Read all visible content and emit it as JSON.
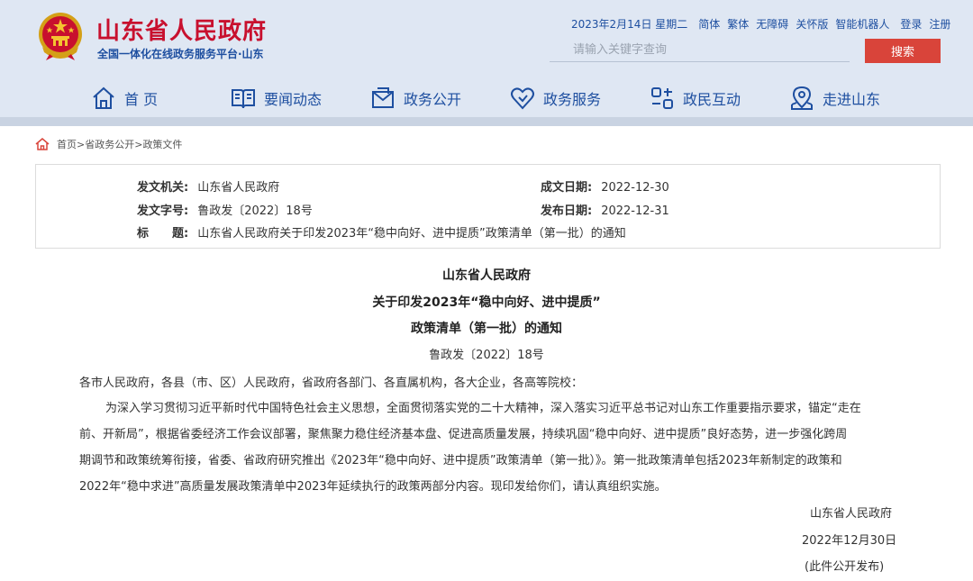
{
  "site": {
    "title": "山东省人民政府",
    "subtitle": "全国一体化在线政务服务平台·山东"
  },
  "top_bar": {
    "date": "2023年2月14日 星期二",
    "links": [
      "简体",
      "繁体",
      "无障碍",
      "关怀版",
      "智能机器人"
    ],
    "login": "登录",
    "register": "注册"
  },
  "search": {
    "placeholder": "请输入关键字查询",
    "button_label": "搜索"
  },
  "nav": {
    "items": [
      {
        "label": "首 页",
        "icon": "home-icon"
      },
      {
        "label": "要闻动态",
        "icon": "book-icon"
      },
      {
        "label": "政务公开",
        "icon": "mail-icon"
      },
      {
        "label": "政务服务",
        "icon": "heart-icon"
      },
      {
        "label": "政民互动",
        "icon": "interaction-icon"
      },
      {
        "label": "走进山东",
        "icon": "location-icon"
      }
    ]
  },
  "breadcrumb": {
    "items": [
      "首页",
      "省政务公开",
      "政策文件"
    ],
    "separator": ">"
  },
  "meta": {
    "issuer_label": "发文机关:",
    "issuer": "山东省人民政府",
    "doc_no_label": "发文字号:",
    "doc_no": "鲁政发〔2022〕18号",
    "title_label": "标　　题:",
    "title": "山东省人民政府关于印发2023年“稳中向好、进中提质”政策清单（第一批）的通知",
    "written_date_label": "成文日期:",
    "written_date": "2022-12-30",
    "publish_date_label": "发布日期:",
    "publish_date": "2022-12-31"
  },
  "article": {
    "title_lines": [
      "山东省人民政府",
      "关于印发2023年“稳中向好、进中提质”",
      "政策清单（第一批）的通知"
    ],
    "doc_no": "鲁政发〔2022〕18号",
    "salutation": "各市人民政府，各县（市、区）人民政府，省政府各部门、各直属机构，各大企业，各高等院校：",
    "body_lines": [
      "为深入学习贯彻习近平新时代中国特色社会主义思想，全面贯彻落实党的二十大精神，深入落实习近平总书记对山东工作重要指示要求，锚定“走在",
      "前、开新局”，根据省委经济工作会议部署，聚焦聚力稳住经济基本盘、促进高质量发展，持续巩固“稳中向好、进中提质”良好态势，进一步强化跨周",
      "期调节和政策统筹衔接，省委、省政府研究推出《2023年“稳中向好、进中提质”政策清单（第一批）》。第一批政策清单包括2023年新制定的政策和",
      "2022年“稳中求进”高质量发展政策清单中2023年延续执行的政策两部分内容。现印发给你们，请认真组织实施。"
    ],
    "signature": "山东省人民政府",
    "sign_date": "2022年12月30日",
    "publish_note": "(此件公开发布)"
  }
}
